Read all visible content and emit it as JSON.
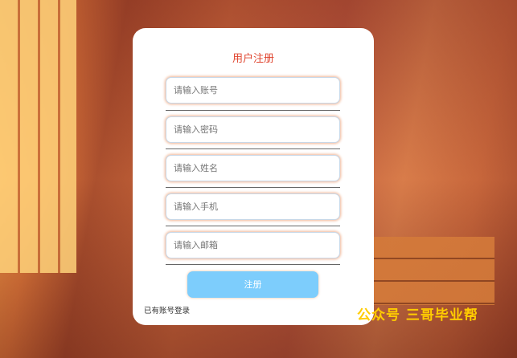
{
  "form": {
    "title": "用户注册",
    "fields": [
      {
        "placeholder": "请输入账号",
        "value": ""
      },
      {
        "placeholder": "请输入密码",
        "value": ""
      },
      {
        "placeholder": "请输入姓名",
        "value": ""
      },
      {
        "placeholder": "请输入手机",
        "value": ""
      },
      {
        "placeholder": "请输入邮箱",
        "value": ""
      }
    ],
    "submit_label": "注册",
    "login_link": "已有账号登录"
  },
  "watermark": "公众号 三哥毕业帮",
  "colors": {
    "title": "#e0452f",
    "button": "#7dcdfc",
    "watermark": "#ffcc00"
  }
}
